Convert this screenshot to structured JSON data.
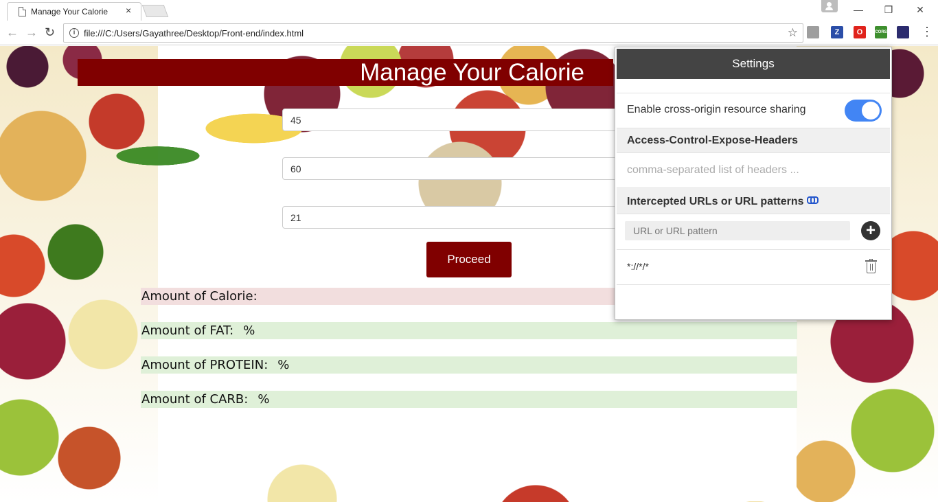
{
  "browser": {
    "tab_title": "Manage Your Calorie",
    "tab_close": "×",
    "url": "file:///C:/Users/Gayathree/Desktop/Front-end/index.html",
    "window_controls": {
      "minimize": "—",
      "restore": "❐",
      "close": "✕"
    },
    "nav": {
      "back": "←",
      "forward": "→",
      "reload": "↻"
    },
    "menu": "⋮",
    "extensions": [
      {
        "name": "pocket-icon",
        "label": "",
        "color": "#9e9e9e"
      },
      {
        "name": "zotero-icon",
        "label": "Z",
        "color": "#2b4ea8"
      },
      {
        "name": "opera-icon",
        "label": "O",
        "color": "#e0231c"
      },
      {
        "name": "cors-extension-icon",
        "label": "CORS",
        "color": "#3e8f2e"
      },
      {
        "name": "flag-extension-icon",
        "label": "",
        "color": "#2c2c6e"
      }
    ]
  },
  "page": {
    "title": "Manage Your Calorie",
    "inputs": [
      "45",
      "60",
      "21"
    ],
    "proceed_label": "Proceed",
    "results": {
      "calorie_label": "Amount of Calorie:",
      "fat_label": "Amount of FAT:",
      "fat_unit": "%",
      "protein_label": "Amount of PROTEIN:",
      "protein_unit": "%",
      "carb_label": "Amount of CARB:",
      "carb_unit": "%"
    },
    "colors": {
      "primary": "#800000",
      "calorie_bg": "#f2dede",
      "macro_bg": "#dff0d8"
    }
  },
  "cors_popup": {
    "header": "Settings",
    "enable_label": "Enable cross-origin resource sharing",
    "enable_on": true,
    "expose_headers_title": "Access-Control-Expose-Headers",
    "expose_headers_placeholder": "comma-separated list of headers ...",
    "intercepted_title": "Intercepted URLs or URL patterns",
    "url_placeholder": "URL or URL pattern",
    "patterns": [
      "*://*/*"
    ],
    "toggle_color": "#4285f4"
  }
}
